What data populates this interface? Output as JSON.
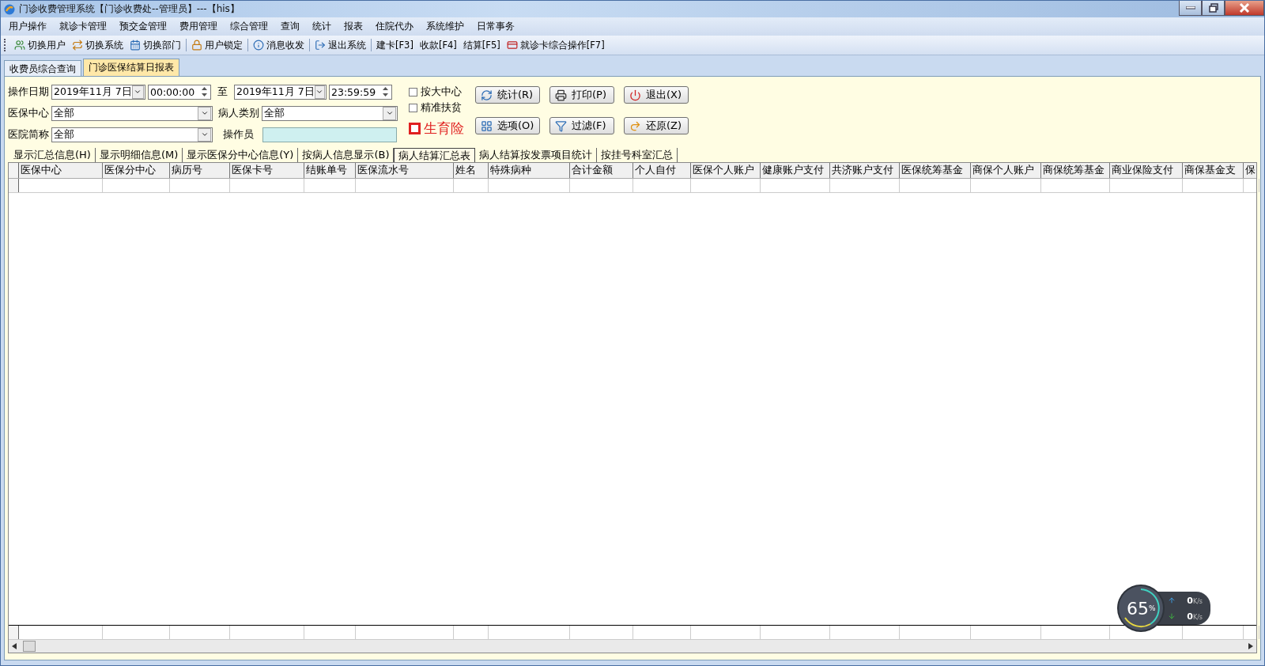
{
  "window": {
    "title": "门诊收费管理系统【门诊收费处--管理员】---【his】"
  },
  "menu": [
    "用户操作",
    "就诊卡管理",
    "预交金管理",
    "费用管理",
    "综合管理",
    "查询",
    "统计",
    "报表",
    "住院代办",
    "系统维护",
    "日常事务"
  ],
  "toolbar": [
    {
      "label": "切换用户",
      "kind": "users"
    },
    {
      "label": "切换系统",
      "kind": "switch"
    },
    {
      "label": "切换部门",
      "kind": "calendar"
    },
    {
      "label": "用户锁定",
      "kind": "lock"
    },
    {
      "label": "消息收发",
      "kind": "info"
    },
    {
      "label": "退出系统",
      "kind": "exit"
    },
    {
      "label": "建卡[F3]",
      "kind": "text"
    },
    {
      "label": "收款[F4]",
      "kind": "text"
    },
    {
      "label": "结算[F5]",
      "kind": "text"
    },
    {
      "label": "就诊卡综合操作[F7]",
      "kind": "card"
    }
  ],
  "tabs": [
    {
      "label": "收费员综合查询",
      "selected": false
    },
    {
      "label": "门诊医保结算日报表",
      "selected": true
    }
  ],
  "filters": {
    "date_label": "操作日期",
    "from_date": "2019年11月 7日",
    "from_time": "00:00:00",
    "to_label": "至",
    "to_date": "2019年11月 7日",
    "to_time": "23:59:59",
    "center_label": "医保中心",
    "center": "全部",
    "patient_type_label": "病人类别",
    "patient_type": "全部",
    "hospital_label": "医院简称",
    "hospital": "全部",
    "operator_label": "操作员"
  },
  "checkboxes": [
    {
      "label": "按大中心",
      "checked": false,
      "kind": "normal"
    },
    {
      "label": "精准扶贫",
      "checked": false,
      "kind": "normal"
    },
    {
      "label": "生育险",
      "checked": false,
      "kind": "alert"
    }
  ],
  "buttons": [
    {
      "label": "统计(R)",
      "kind": "stats"
    },
    {
      "label": "选项(O)",
      "kind": "options"
    },
    {
      "label": "打印(P)",
      "kind": "print"
    },
    {
      "label": "过滤(F)",
      "kind": "filter"
    },
    {
      "label": "退出(X)",
      "kind": "exit"
    },
    {
      "label": "还原(Z)",
      "kind": "restore"
    }
  ],
  "view_tabs": [
    {
      "label": "显示汇总信息(H)",
      "selected": false
    },
    {
      "label": "显示明细信息(M)",
      "selected": false
    },
    {
      "label": "显示医保分中心信息(Y)",
      "selected": false
    },
    {
      "label": "按病人信息显示(B)",
      "selected": false
    },
    {
      "label": "病人结算汇总表",
      "selected": true
    },
    {
      "label": "病人结算按发票项目统计",
      "selected": false
    },
    {
      "label": "按挂号科室汇总",
      "selected": false
    }
  ],
  "table": {
    "columns": [
      "医保中心",
      "医保分中心",
      "病历号",
      "医保卡号",
      "结账单号",
      "医保流水号",
      "姓名",
      "特殊病种",
      "合计金额",
      "个人自付",
      "医保个人账户",
      "健康账户支付",
      "共济账户支付",
      "医保统筹基金",
      "商保个人账户",
      "商保统筹基金",
      "商业保险支付",
      "商保基金支",
      "保"
    ]
  },
  "net_monitor": {
    "percent": "65",
    "percent_unit": "%",
    "upload": "0",
    "upload_unit": "K/s",
    "download": "0",
    "download_unit": "K/s"
  }
}
